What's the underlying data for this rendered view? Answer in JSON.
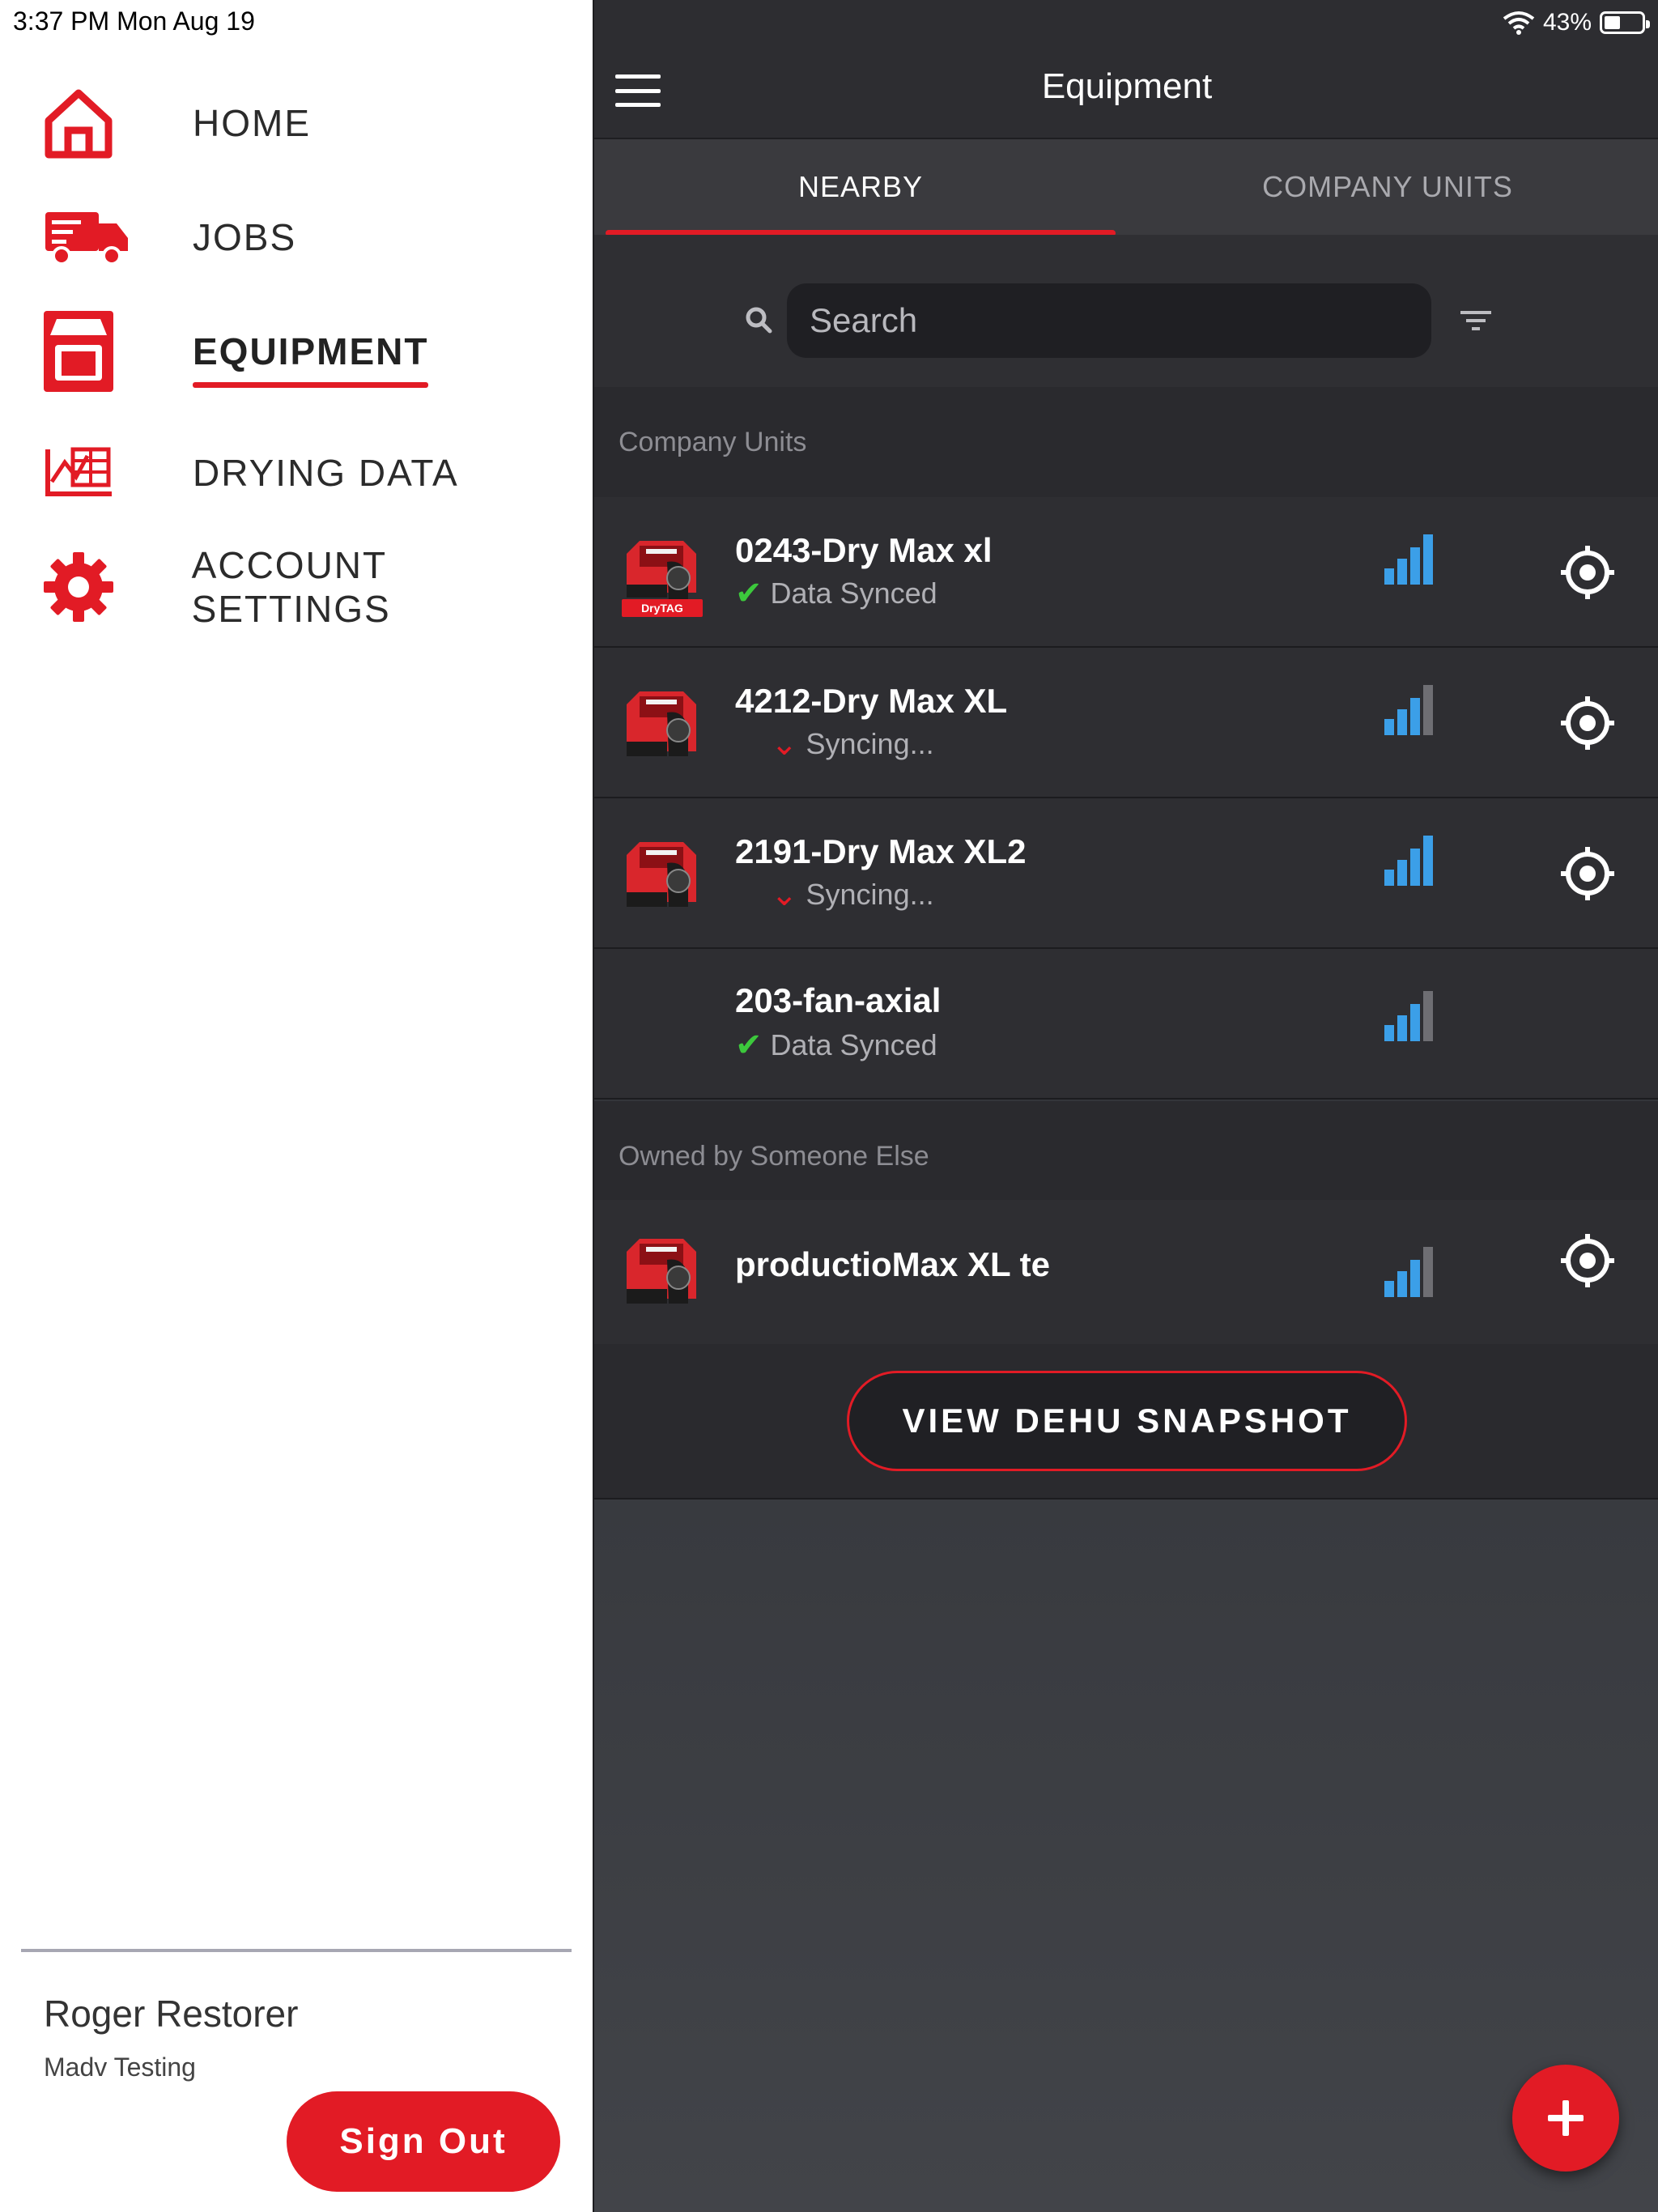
{
  "status_bar": {
    "time": "3:37 PM   Mon Aug 19",
    "battery": "43%"
  },
  "sidebar": {
    "items": [
      {
        "label": "HOME",
        "icon": "home-icon"
      },
      {
        "label": "JOBS",
        "icon": "truck-icon"
      },
      {
        "label": "EQUIPMENT",
        "icon": "equipment-icon",
        "active": true
      },
      {
        "label": "DRYING DATA",
        "icon": "drying-data-icon"
      },
      {
        "label": "ACCOUNT SETTINGS",
        "icon": "gear-icon"
      }
    ],
    "user_name": "Roger Restorer",
    "company": "Madv Testing",
    "sign_out_label": "Sign Out"
  },
  "header": {
    "title": "Equipment"
  },
  "tabs": [
    {
      "label": "NEARBY",
      "active": true
    },
    {
      "label": "COMPANY UNITS",
      "active": false
    }
  ],
  "search": {
    "placeholder": "Search"
  },
  "sections": [
    {
      "title": "Company Units",
      "rows": [
        {
          "name": "0243-Dry Max xl",
          "status": "Data Synced",
          "status_type": "synced",
          "thumb": "dehumidifier-drytag",
          "badge": "DryTAG",
          "signal_bars": 4,
          "locate": true
        },
        {
          "name": "4212-Dry Max XL",
          "status": "Syncing...",
          "status_type": "syncing",
          "thumb": "dehumidifier",
          "signal_bars": 3,
          "locate": true
        },
        {
          "name": "2191-Dry Max XL2",
          "status": "Syncing...",
          "status_type": "syncing",
          "thumb": "dehumidifier",
          "signal_bars": 4,
          "locate": true
        },
        {
          "name": "203-fan-axial",
          "status": "Data Synced",
          "status_type": "synced",
          "thumb": "none",
          "signal_bars": 3,
          "locate": false
        }
      ]
    },
    {
      "title": "Owned by Someone Else",
      "rows": [
        {
          "name": "productioMax XL te",
          "status": "",
          "status_type": "none",
          "thumb": "dehumidifier",
          "signal_bars": 3,
          "locate": true
        }
      ]
    }
  ],
  "snapshot_button_label": "VIEW DEHU SNAPSHOT",
  "colors": {
    "accent": "#e21b25",
    "signal_on": "#3b9fe8",
    "signal_off": "#6e6e73",
    "synced": "#3cc83c",
    "panel_bg": "#2e2e32"
  }
}
